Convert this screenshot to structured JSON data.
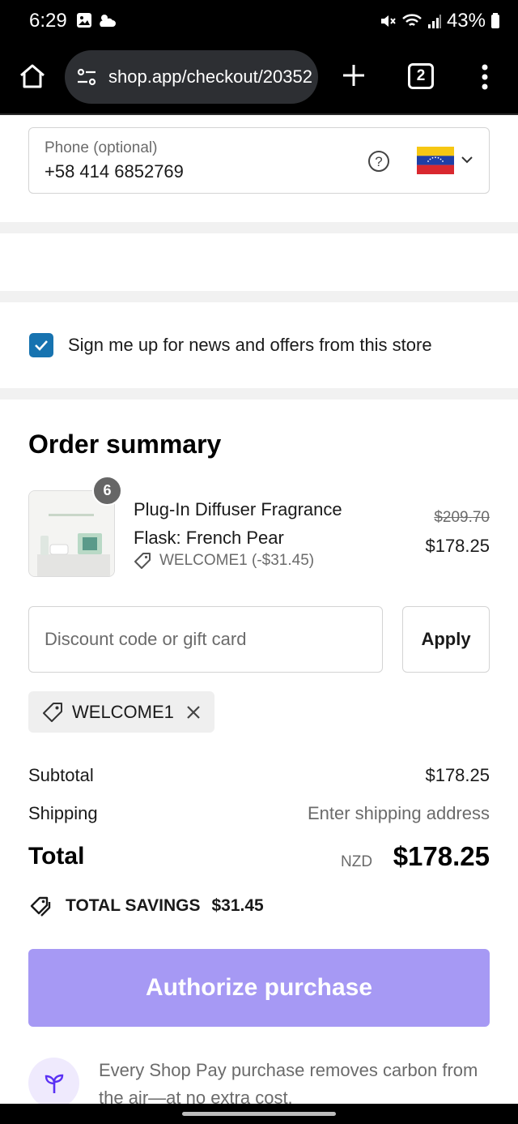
{
  "status_bar": {
    "time": "6:29",
    "battery": "43%",
    "icons": [
      "gallery-icon",
      "weather-icon",
      "mute-icon",
      "wifi-icon",
      "signal-icon",
      "battery-icon"
    ]
  },
  "browser": {
    "url": "shop.app/checkout/20352",
    "tab_count": "2",
    "icons": [
      "home-icon",
      "site-settings-icon",
      "new-tab-icon",
      "tabs-icon",
      "overflow-menu-icon"
    ]
  },
  "contact": {
    "phone_label": "Phone (optional)",
    "phone_value": "+58 414 6852769",
    "country_flag": "Venezuela"
  },
  "newsletter": {
    "label": "Sign me up for news and offers from this store",
    "checked": true
  },
  "order_summary": {
    "title": "Order summary",
    "item": {
      "quantity": "6",
      "name": "Plug-In Diffuser Fragrance Flask: French Pear",
      "discount": "WELCOME1 (-$31.45)",
      "original_price": "$209.70",
      "price": "$178.25"
    },
    "discount_field": {
      "placeholder": "Discount code or gift card",
      "value": ""
    },
    "apply_label": "Apply",
    "applied_code": "WELCOME1",
    "subtotal_label": "Subtotal",
    "subtotal_value": "$178.25",
    "shipping_label": "Shipping",
    "shipping_value": "Enter shipping address",
    "total_label": "Total",
    "total_currency": "NZD",
    "total_value": "$178.25",
    "savings_label": "TOTAL SAVINGS",
    "savings_value": "$31.45"
  },
  "checkout": {
    "authorize_label": "Authorize purchase",
    "eco_message": "Every Shop Pay purchase removes carbon from the air—at no extra cost."
  },
  "colors": {
    "accent_checkbox": "#1773b0",
    "authorize_button": "#a699f4",
    "eco_circle": "#efeafd",
    "eco_icon": "#5a31f4"
  }
}
